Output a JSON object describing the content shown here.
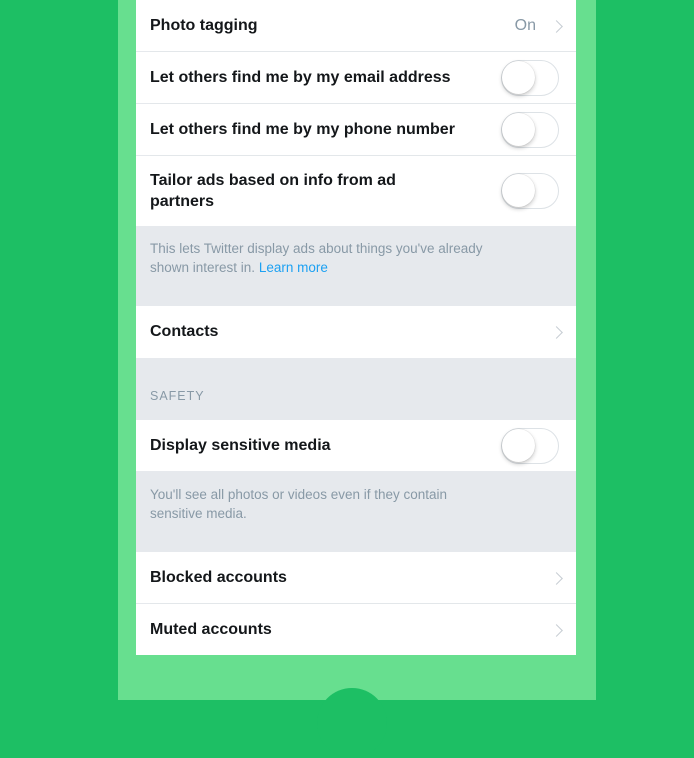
{
  "rows": {
    "photo_tagging": {
      "label": "Photo tagging",
      "value": "On"
    },
    "find_by_email": {
      "label": "Let others find me by my email address",
      "toggle": false
    },
    "find_by_phone": {
      "label": "Let others find me by my phone number",
      "toggle": false
    },
    "tailor_ads": {
      "label_line1": "Tailor ads based on info from ad",
      "label_line2": "partners",
      "toggle": false
    },
    "contacts": {
      "label": "Contacts"
    },
    "display_sensitive": {
      "label": "Display sensitive media",
      "toggle": false
    },
    "blocked": {
      "label": "Blocked accounts"
    },
    "muted": {
      "label": "Muted accounts"
    }
  },
  "notes": {
    "ads_line1": "This lets Twitter display ads about things you've already",
    "ads_line2": "shown interest in.",
    "ads_link": "Learn more",
    "sensitive_line1": "You'll see all photos or videos even if they contain",
    "sensitive_line2": "sensitive media."
  },
  "sections": {
    "safety": "SAFETY"
  },
  "colors": {
    "background": "#1dbf64",
    "phone_frame": "#67df8f",
    "link": "#1da1f2",
    "secondary_text": "#8899a6"
  }
}
